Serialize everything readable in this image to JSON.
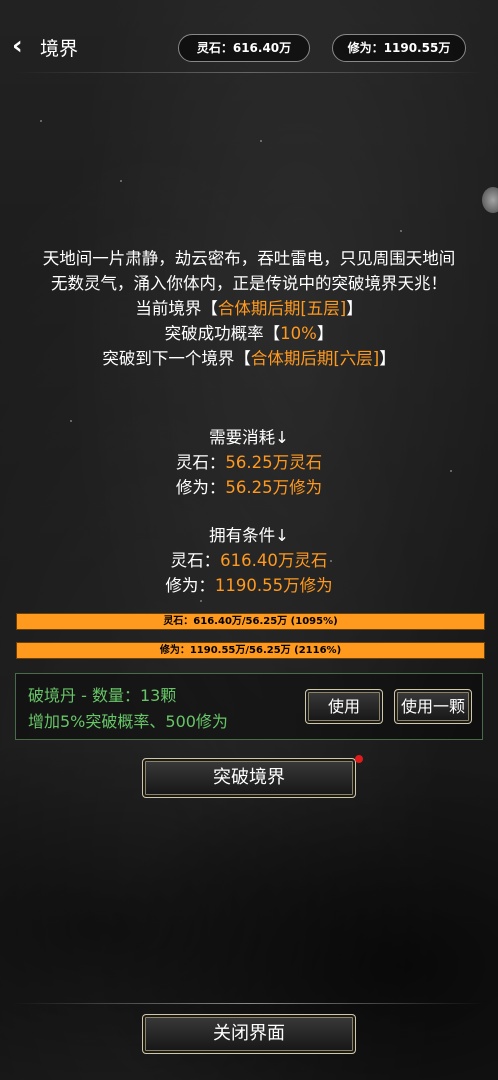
{
  "header": {
    "title": "境界",
    "spirit_stone": "灵石：616.40万",
    "cultivation": "修为：1190.55万"
  },
  "story": {
    "line1": "天地间一片肃静，劫云密布，吞吐雷电，只见周围天地间",
    "line2": "无数灵气，涌入你体内，正是传说中的突破境界天兆！",
    "current_label": "当前境界【",
    "current_value": "合体期后期[五层]",
    "current_end": "】",
    "rate_label": "突破成功概率【",
    "rate_value": "10%",
    "rate_end": "】",
    "next_label": "突破到下一个境界【",
    "next_value": "合体期后期[六层]",
    "next_end": "】"
  },
  "cost": {
    "heading": "需要消耗↓",
    "stone_label": "灵石：",
    "stone_value": "56.25万灵石",
    "cult_label": "修为：",
    "cult_value": "56.25万修为"
  },
  "owned": {
    "heading": "拥有条件↓",
    "stone_label": "灵石：",
    "stone_value": "616.40万灵石",
    "cult_label": "修为：",
    "cult_value": "1190.55万修为"
  },
  "bars": {
    "stone_text": "灵石：616.40万/56.25万 (1095%)",
    "stone_progress": 1.0,
    "cult_text": "修为：1190.55万/56.25万 (2116%)",
    "cult_progress": 1.0
  },
  "item": {
    "name": "破境丹 - 数量：13颗",
    "desc": "增加5%突破概率、500修为",
    "use_label": "使用",
    "use_one_label": "使用一颗"
  },
  "actions": {
    "breakthrough_label": "突破境界",
    "close_label": "关闭界面"
  },
  "colors": {
    "highlight": "#ff9a1f",
    "item_text": "#67c567",
    "bar_fill": "#ff9a1f",
    "notification_dot": "#e01b1b"
  }
}
